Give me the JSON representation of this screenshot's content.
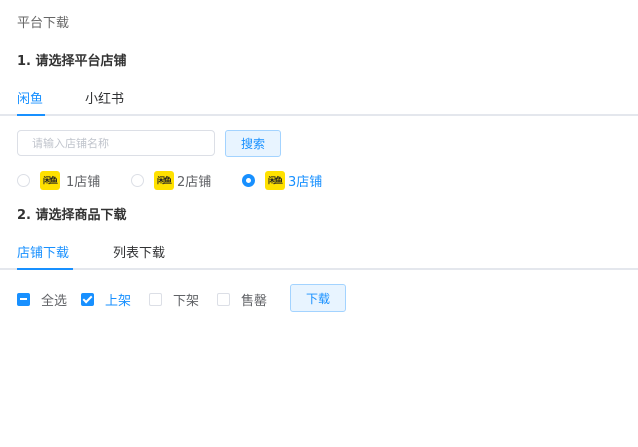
{
  "page": {
    "title": "平台下载"
  },
  "step1": {
    "title": "1. 请选择平台店铺",
    "tabs": [
      {
        "label": "闲鱼",
        "active": true
      },
      {
        "label": "小红书",
        "active": false
      }
    ],
    "search": {
      "placeholder": "请输入店铺名称",
      "value": "",
      "button_label": "搜索"
    },
    "stores": [
      {
        "logo_text": "闲鱼",
        "label": "1店铺",
        "checked": false
      },
      {
        "logo_text": "闲鱼",
        "label": "2店铺",
        "checked": false
      },
      {
        "logo_text": "闲鱼",
        "label": "3店铺",
        "checked": true
      }
    ]
  },
  "step2": {
    "title": "2. 请选择商品下载",
    "tabs": [
      {
        "label": "店铺下载",
        "active": true
      },
      {
        "label": "列表下载",
        "active": false
      }
    ],
    "filters": [
      {
        "label": "全选",
        "state": "indeterminate"
      },
      {
        "label": "上架",
        "state": "checked"
      },
      {
        "label": "下架",
        "state": "unchecked"
      },
      {
        "label": "售罄",
        "state": "unchecked"
      }
    ],
    "download_label": "下载"
  },
  "colors": {
    "accent": "#1890ff",
    "store_logo": "#ffe100",
    "divider": "#e4e7ed"
  }
}
